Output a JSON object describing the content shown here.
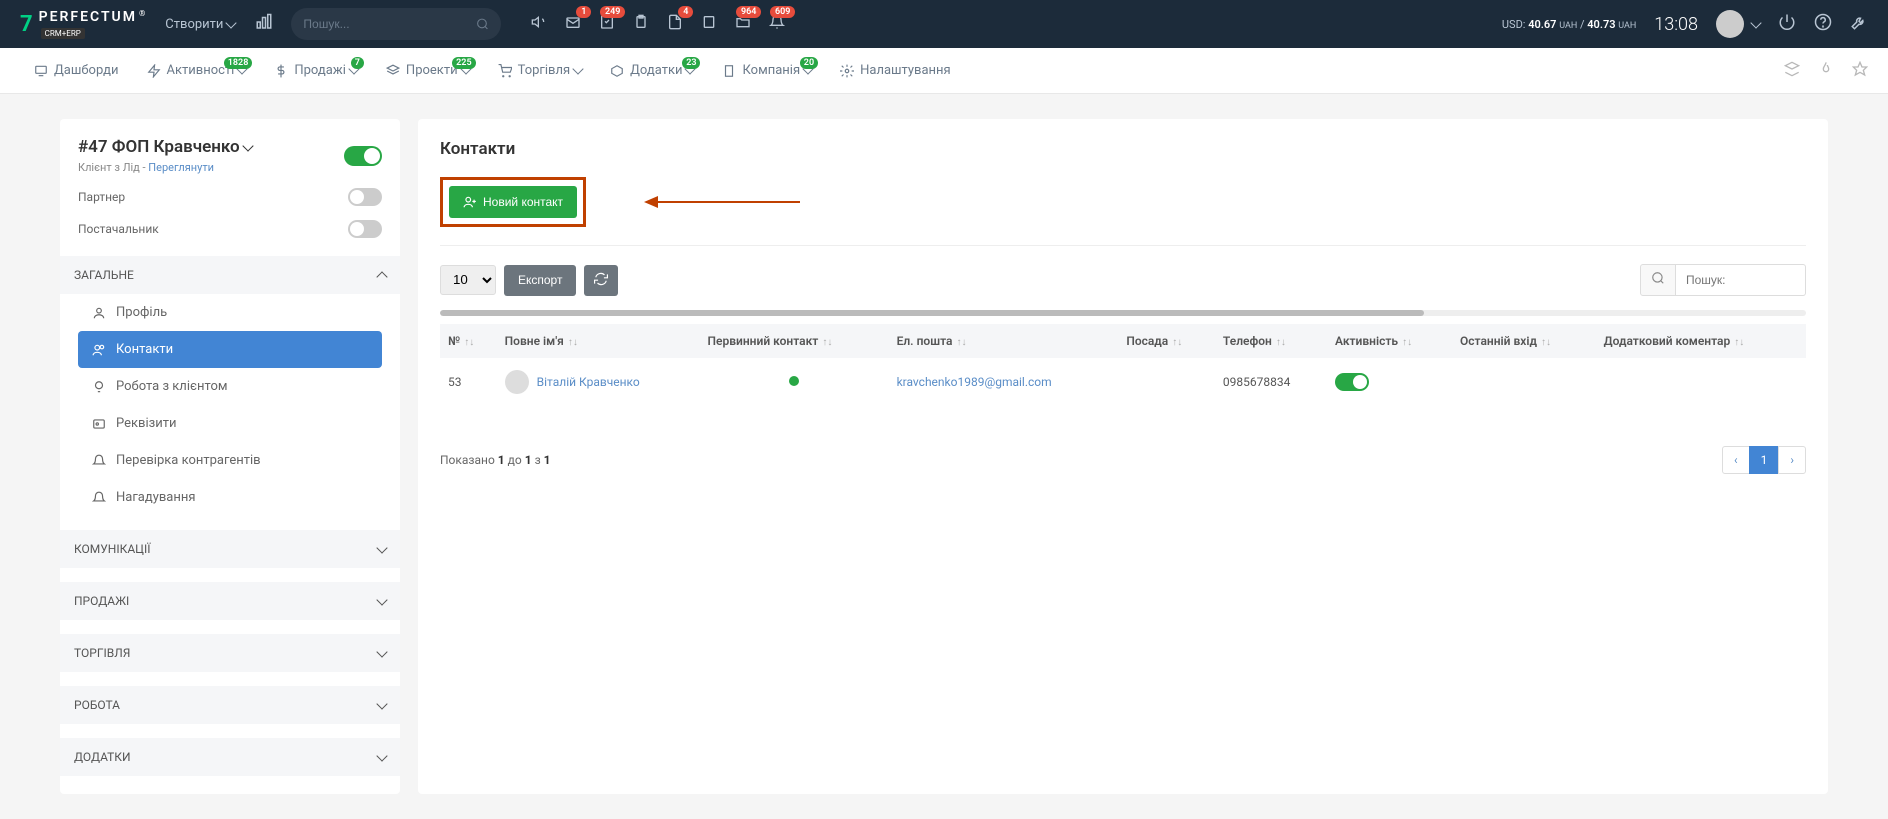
{
  "header": {
    "logo_text": "PERFECTUM",
    "logo_badge": "CRM+ERP",
    "create_label": "Створити",
    "search_placeholder": "Пошук...",
    "badges": {
      "mail": "1",
      "tasks": "249",
      "docs": "4",
      "files": "964",
      "notif": "609"
    },
    "currency_prefix": "USD:",
    "currency_val1": "40.67",
    "currency_unit": "UAH",
    "currency_sep": "/",
    "currency_val2": "40.73",
    "time": "13:08"
  },
  "nav": {
    "dashboards": "Дашборди",
    "activities": "Активності",
    "activities_badge": "1828",
    "sales": "Продажі",
    "sales_badge": "7",
    "projects": "Проекти",
    "projects_badge": "225",
    "trade": "Торгівля",
    "addons": "Додатки",
    "addons_badge": "23",
    "company": "Компанія",
    "company_badge": "20",
    "settings": "Налаштування"
  },
  "sidebar": {
    "client_title": "#47 ФОП Кравченко",
    "client_meta_prefix": "Клієнт з Лід - ",
    "client_meta_link": "Переглянути",
    "partner_label": "Партнер",
    "supplier_label": "Постачальник",
    "section_general": "ЗАГАЛЬНЕ",
    "menu_profile": "Профіль",
    "menu_contacts": "Контакти",
    "menu_client_work": "Робота з клієнтом",
    "menu_requisites": "Реквізити",
    "menu_check": "Перевірка контрагентів",
    "menu_reminders": "Нагадування",
    "section_comm": "КОМУНІКАЦІЇ",
    "section_sales": "ПРОДАЖІ",
    "section_trade": "ТОРГІВЛЯ",
    "section_work": "РОБОТА",
    "section_addons": "ДОДАТКИ"
  },
  "content": {
    "title": "Контакти",
    "new_contact_btn": "Новий контакт",
    "page_size": "10",
    "export_btn": "Експорт",
    "search_placeholder": "Пошук:",
    "columns": {
      "num": "№",
      "fullname": "Повне ім'я",
      "primary": "Первинний контакт",
      "email": "Ел. пошта",
      "position": "Посада",
      "phone": "Телефон",
      "activity": "Активність",
      "last_login": "Останній вхід",
      "comment": "Додатковий коментар"
    },
    "rows": [
      {
        "num": "53",
        "name": "Віталій Кравченко",
        "email": "kravchenko1989@gmail.com",
        "phone": "0985678834"
      }
    ],
    "page_info_prefix": "Показано ",
    "page_info_1": "1",
    "page_info_to": " до ",
    "page_info_2": "1",
    "page_info_of": " з ",
    "page_info_3": "1",
    "page_current": "1"
  }
}
